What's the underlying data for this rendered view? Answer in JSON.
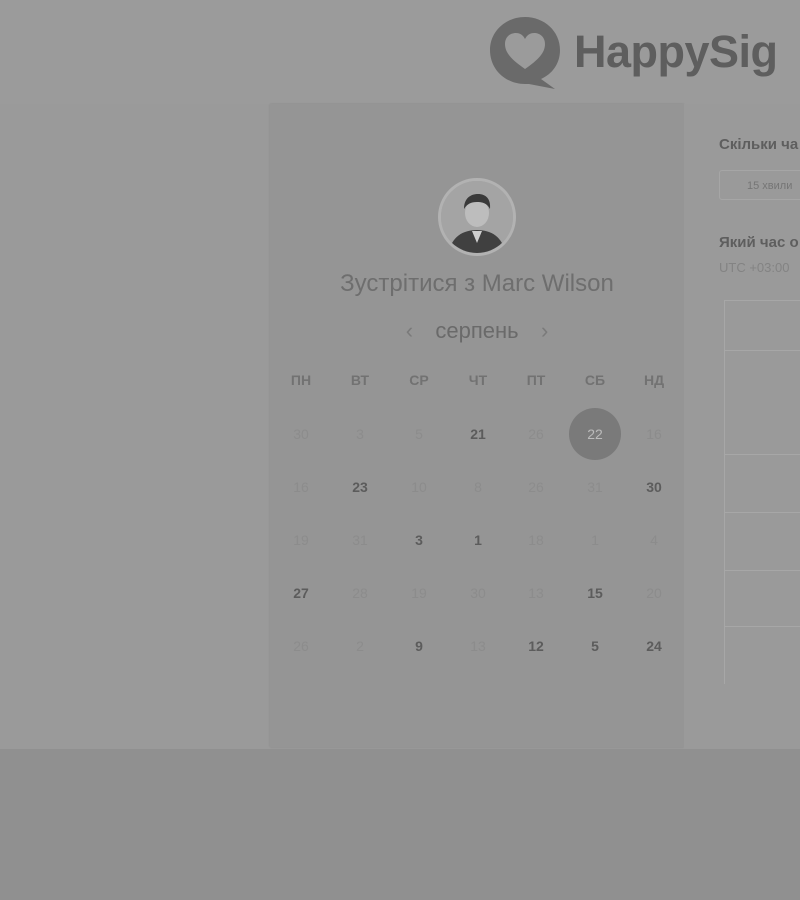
{
  "brand": {
    "name": "HappySig"
  },
  "calendar": {
    "title": "Зустрітися з Marc Wilson",
    "month": "серпень",
    "prev_icon": "chevron-left-icon",
    "next_icon": "chevron-right-icon",
    "weekdays": [
      "ПН",
      "ВТ",
      "СР",
      "ЧТ",
      "ПТ",
      "СБ",
      "НД"
    ],
    "weeks": [
      [
        {
          "d": "30",
          "a": false
        },
        {
          "d": "3",
          "a": false
        },
        {
          "d": "5",
          "a": false
        },
        {
          "d": "21",
          "a": true
        },
        {
          "d": "26",
          "a": false
        },
        {
          "d": "22",
          "a": true,
          "selected": true
        },
        {
          "d": "16",
          "a": false
        }
      ],
      [
        {
          "d": "16",
          "a": false
        },
        {
          "d": "23",
          "a": true
        },
        {
          "d": "10",
          "a": false
        },
        {
          "d": "8",
          "a": false
        },
        {
          "d": "26",
          "a": false
        },
        {
          "d": "31",
          "a": false
        },
        {
          "d": "30",
          "a": true
        }
      ],
      [
        {
          "d": "19",
          "a": false
        },
        {
          "d": "31",
          "a": false
        },
        {
          "d": "3",
          "a": true
        },
        {
          "d": "1",
          "a": true
        },
        {
          "d": "18",
          "a": false
        },
        {
          "d": "1",
          "a": false
        },
        {
          "d": "4",
          "a": false
        }
      ],
      [
        {
          "d": "27",
          "a": true
        },
        {
          "d": "28",
          "a": false
        },
        {
          "d": "19",
          "a": false
        },
        {
          "d": "30",
          "a": false
        },
        {
          "d": "13",
          "a": false
        },
        {
          "d": "15",
          "a": true
        },
        {
          "d": "20",
          "a": false
        }
      ],
      [
        {
          "d": "26",
          "a": false
        },
        {
          "d": "2",
          "a": false
        },
        {
          "d": "9",
          "a": true
        },
        {
          "d": "13",
          "a": false
        },
        {
          "d": "12",
          "a": true
        },
        {
          "d": "5",
          "a": true
        },
        {
          "d": "24",
          "a": true
        }
      ]
    ]
  },
  "right_panel": {
    "duration_label": "Скільки ча",
    "duration_value": "15 хвили",
    "time_label": "Який час о",
    "timezone": "UTC +03:00"
  },
  "colors": {
    "background": "#8f8f8f",
    "card": "#959595",
    "selected_day": "#7a7a7a"
  }
}
